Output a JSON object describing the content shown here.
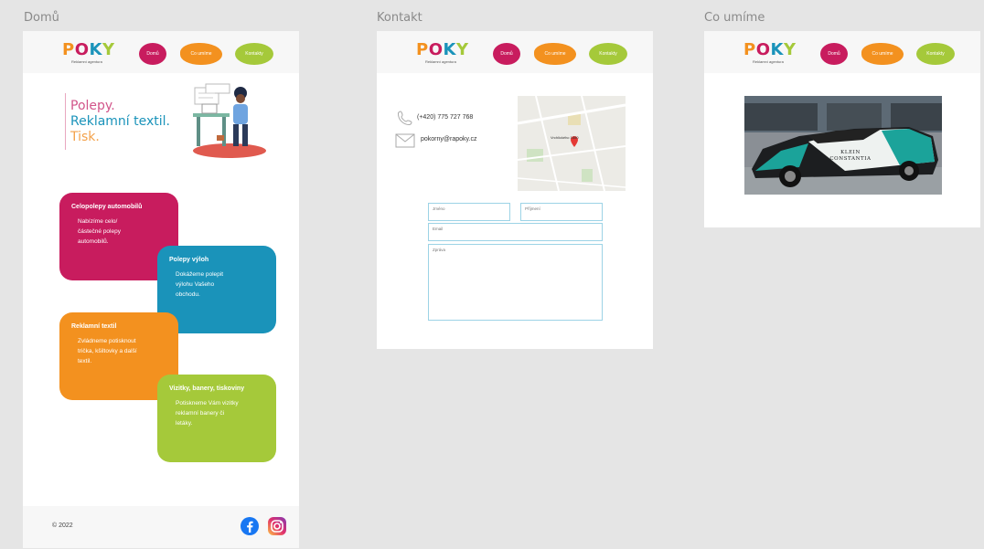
{
  "frames": {
    "home": {
      "label": "Domů"
    },
    "contact": {
      "label": "Kontakt"
    },
    "services": {
      "label": "Co umíme"
    }
  },
  "logo": {
    "text": "POKY",
    "subtitle": "Reklamní agentura"
  },
  "nav": {
    "home": "Domů",
    "services": "Co umíme",
    "contact": "Kontakty"
  },
  "colors": {
    "magenta": "#c81c5e",
    "orange": "#f3911f",
    "lime": "#a5c93a",
    "teal": "#1a93ba"
  },
  "hero": {
    "line1": "Polepy.",
    "line2": "Reklamní textil.",
    "line3": "Tisk."
  },
  "cards": [
    {
      "title": "Celopolepy automobilů",
      "desc": "Nabízíme celo/ částečné polepy automobilů."
    },
    {
      "title": "Polepy výloh",
      "desc": "Dokážeme polepit výlohu Vašeho obchodu."
    },
    {
      "title": "Reklamní textil",
      "desc": "Zvládneme potisknout trička, kšiltovky a další textil."
    },
    {
      "title": "Vizitky, banery, tiskoviny",
      "desc": "Potiskneme Vám vizitky reklamní banery či letáky."
    }
  ],
  "footer": {
    "copyright": "© 2022"
  },
  "social": {
    "facebook_icon": "facebook-icon",
    "instagram_icon": "instagram-icon"
  },
  "contact": {
    "phone": "(+420) 775 727 768",
    "email": "pokorny@rapoky.cz",
    "map_label": "Vrchlického 1880",
    "form": {
      "name": "Jméno",
      "surname": "Příjmení",
      "email": "Email",
      "message": "Zpráva"
    }
  },
  "services": {
    "photo_text": "KLEIN CONSTANTIA"
  }
}
